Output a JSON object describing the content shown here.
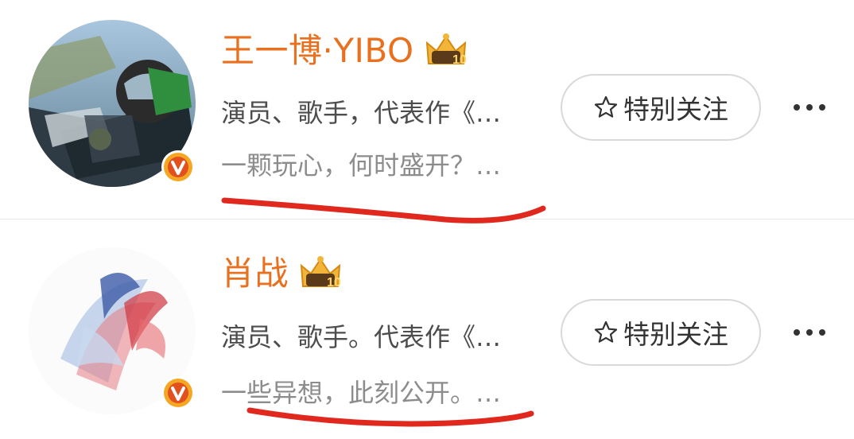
{
  "users": [
    {
      "name": "王一博·YIBO",
      "level": "10",
      "description": "演员、歌手，代表作《…",
      "tagline": "一颗玩心，何时盛开？…",
      "follow_label": "特别关注",
      "verified_icon": "verified-v-icon"
    },
    {
      "name": "肖战",
      "level": "10",
      "description": "演员、歌手。代表作《…",
      "tagline": "一些异想，此刻公开。…",
      "follow_label": "特别关注",
      "verified_icon": "verified-v-icon"
    }
  ],
  "colors": {
    "name": "#e8701e",
    "verified_badge": "#f5a623",
    "annotation_underline": "#e0281e"
  }
}
